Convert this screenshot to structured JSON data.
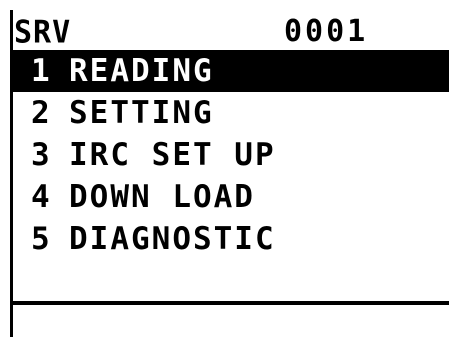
{
  "header": {
    "mode": "SRV",
    "code": "0001"
  },
  "menu": {
    "items": [
      {
        "number": "1",
        "label": "READING",
        "selected": true
      },
      {
        "number": "2",
        "label": "SETTING",
        "selected": false
      },
      {
        "number": "3",
        "label": "IRC SET UP",
        "selected": false
      },
      {
        "number": "4",
        "label": "DOWN LOAD",
        "selected": false
      },
      {
        "number": "5",
        "label": "DIAGNOSTIC",
        "selected": false
      }
    ]
  },
  "colors": {
    "background": "#ffffff",
    "foreground": "#000000",
    "highlight": "#000000",
    "highlight_text": "#ffffff"
  }
}
